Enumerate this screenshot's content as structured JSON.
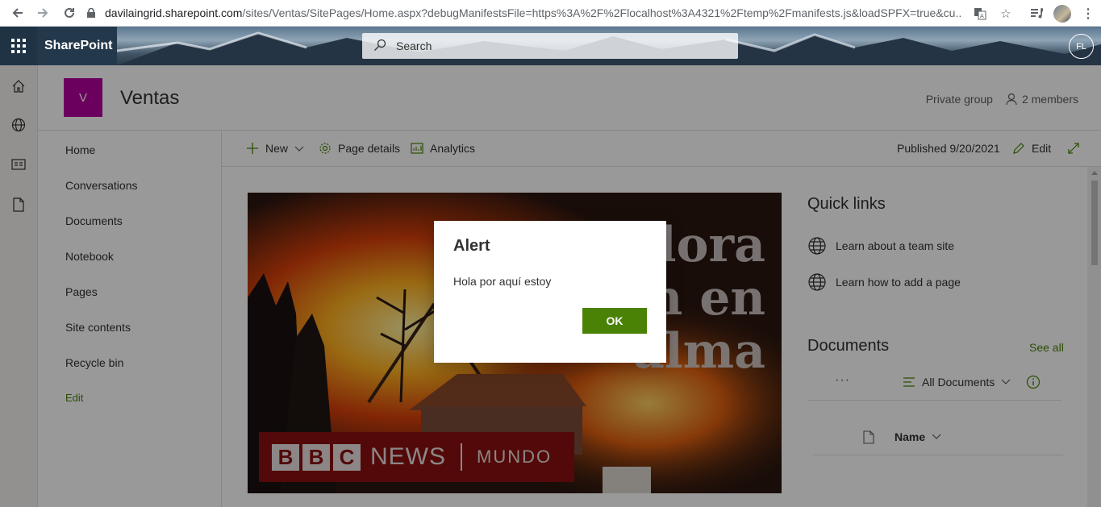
{
  "browser": {
    "url_host": "davilaingrid.sharepoint.com",
    "url_rest": "/sites/Ventas/SitePages/Home.aspx?debugManifestsFile=https%3A%2F%2Flocalhost%3A4321%2Ftemp%2Fmanifests.js&loadSPFX=true&cu..."
  },
  "suite": {
    "brand": "SharePoint",
    "search_placeholder": "Search",
    "user_initials": "FL"
  },
  "site": {
    "logo_letter": "V",
    "title": "Ventas",
    "privacy": "Private group",
    "members": "2 members",
    "logo_color": "#b4009e"
  },
  "quick_launch": {
    "items": [
      "Home",
      "Conversations",
      "Documents",
      "Notebook",
      "Pages",
      "Site contents",
      "Recycle bin"
    ],
    "edit": "Edit"
  },
  "command_bar": {
    "new": "New",
    "page_details": "Page details",
    "analytics": "Analytics",
    "published": "Published 9/20/2021",
    "edit": "Edit"
  },
  "hero": {
    "bbc_letters": [
      "B",
      "B",
      "C"
    ],
    "bbc_news": "NEWS",
    "bbc_mundo": "MUNDO",
    "headline_1": "dora",
    "headline_2": "n en",
    "headline_3": "alma"
  },
  "quick_links": {
    "title": "Quick links",
    "links": [
      "Learn about a team site",
      "Learn how to add a page"
    ]
  },
  "documents": {
    "title": "Documents",
    "see_all": "See all",
    "more": "···",
    "view": "All Documents",
    "column_name": "Name"
  },
  "dialog": {
    "title": "Alert",
    "message": "Hola por aquí estoy",
    "ok": "OK"
  },
  "colors": {
    "accent": "#498205",
    "suite": "#24384b"
  }
}
